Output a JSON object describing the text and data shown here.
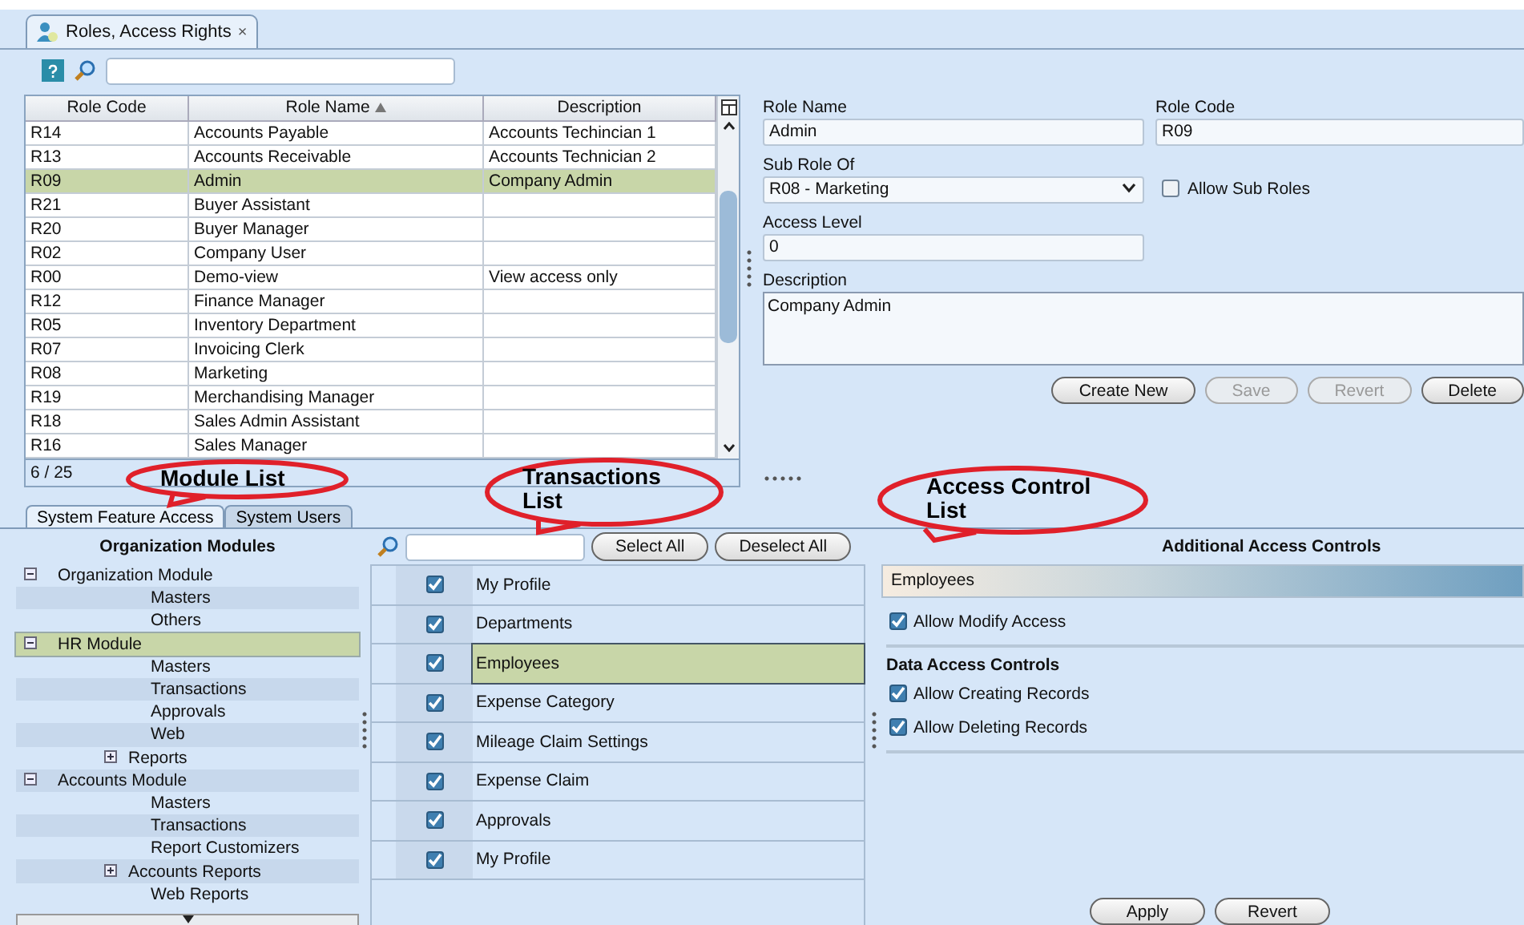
{
  "document_tab": {
    "title": "Roles, Access Rights",
    "close": "×"
  },
  "roles_table": {
    "columns": [
      {
        "label": "Role Code",
        "sorted": false
      },
      {
        "label": "Role Name",
        "sorted": true
      },
      {
        "label": "Description",
        "sorted": false
      }
    ],
    "rows": [
      {
        "code": "R14",
        "name": "Accounts Payable",
        "description": "Accounts Techincian 1",
        "selected": false
      },
      {
        "code": "R13",
        "name": "Accounts Receivable",
        "description": "Accounts Technician 2",
        "selected": false
      },
      {
        "code": "R09",
        "name": "Admin",
        "description": "Company Admin",
        "selected": true
      },
      {
        "code": "R21",
        "name": "Buyer Assistant",
        "description": "",
        "selected": false
      },
      {
        "code": "R20",
        "name": "Buyer Manager",
        "description": "",
        "selected": false
      },
      {
        "code": "R02",
        "name": "Company User",
        "description": "",
        "selected": false
      },
      {
        "code": "R00",
        "name": "Demo-view",
        "description": "View access only",
        "selected": false
      },
      {
        "code": "R12",
        "name": "Finance Manager",
        "description": "",
        "selected": false
      },
      {
        "code": "R05",
        "name": "Inventory Department",
        "description": "",
        "selected": false
      },
      {
        "code": "R07",
        "name": "Invoicing Clerk",
        "description": "",
        "selected": false
      },
      {
        "code": "R08",
        "name": "Marketing",
        "description": "",
        "selected": false
      },
      {
        "code": "R19",
        "name": "Merchandising Manager",
        "description": "",
        "selected": false
      },
      {
        "code": "R18",
        "name": "Sales Admin Assistant",
        "description": "",
        "selected": false
      },
      {
        "code": "R16",
        "name": "Sales Manager",
        "description": "",
        "selected": false
      }
    ],
    "count": "6 / 25"
  },
  "role_form": {
    "role_name": {
      "label": "Role Name",
      "value": "Admin"
    },
    "role_code": {
      "label": "Role Code",
      "value": "R09"
    },
    "sub_role_of": {
      "label": "Sub Role Of",
      "value": "R08 - Marketing"
    },
    "allow_sub_roles": {
      "label": "Allow Sub Roles",
      "checked": false
    },
    "access_level": {
      "label": "Access Level",
      "value": "0"
    },
    "description": {
      "label": "Description",
      "value": "Company Admin"
    },
    "buttons": [
      {
        "label": "Create New",
        "disabled": false
      },
      {
        "label": "Save",
        "disabled": true
      },
      {
        "label": "Revert",
        "disabled": true
      },
      {
        "label": "Delete",
        "disabled": false
      }
    ]
  },
  "lower_tabs": [
    {
      "label": "System Feature Access",
      "selected": true
    },
    {
      "label": "System Users",
      "selected": false
    }
  ],
  "modules": {
    "title": "Organization Modules",
    "items": [
      {
        "label": "Organization Module",
        "expanded": true,
        "selected": false,
        "children": [
          {
            "label": "Masters",
            "selected": false
          },
          {
            "label": "Others",
            "selected": false
          }
        ]
      },
      {
        "label": "HR Module",
        "expanded": true,
        "selected": true,
        "children": [
          {
            "label": "Masters",
            "selected": false
          },
          {
            "label": "Transactions",
            "selected": false
          },
          {
            "label": "Approvals",
            "selected": false
          },
          {
            "label": "Web",
            "selected": false
          },
          {
            "label": "Reports",
            "expanded": false,
            "selected": false
          }
        ]
      },
      {
        "label": "Accounts Module",
        "expanded": true,
        "selected": false,
        "children": [
          {
            "label": "Masters",
            "selected": false
          },
          {
            "label": "Transactions",
            "selected": false
          },
          {
            "label": "Report Customizers",
            "selected": false
          },
          {
            "label": "Accounts Reports",
            "expanded": false,
            "selected": false
          },
          {
            "label": "Web Reports",
            "selected": false
          }
        ]
      }
    ]
  },
  "transactions": {
    "buttons": [
      "Select All",
      "Deselect All"
    ],
    "items": [
      {
        "label": "My Profile",
        "checked": true,
        "selected": false
      },
      {
        "label": "Departments",
        "checked": true,
        "selected": false
      },
      {
        "label": "Employees",
        "checked": true,
        "selected": true
      },
      {
        "label": "Expense Category",
        "checked": true,
        "selected": false
      },
      {
        "label": "Mileage Claim Settings",
        "checked": true,
        "selected": false
      },
      {
        "label": "Expense Claim",
        "checked": true,
        "selected": false
      },
      {
        "label": "Approvals",
        "checked": true,
        "selected": false
      },
      {
        "label": "My Profile",
        "checked": true,
        "selected": false
      }
    ]
  },
  "access_controls": {
    "title": "Additional Access Controls",
    "transaction": "Employees",
    "modify": [
      {
        "label": "Allow Modify Access",
        "checked": true
      }
    ],
    "data_title": "Data Access Controls",
    "data": [
      {
        "label": "Allow Creating Records",
        "checked": true
      },
      {
        "label": "Allow Deleting Records",
        "checked": true
      }
    ],
    "buttons": [
      "Apply",
      "Revert"
    ]
  },
  "annotations": [
    {
      "text": "Module List"
    },
    {
      "text": "Transactions List"
    },
    {
      "text": "Access Control List"
    }
  ]
}
